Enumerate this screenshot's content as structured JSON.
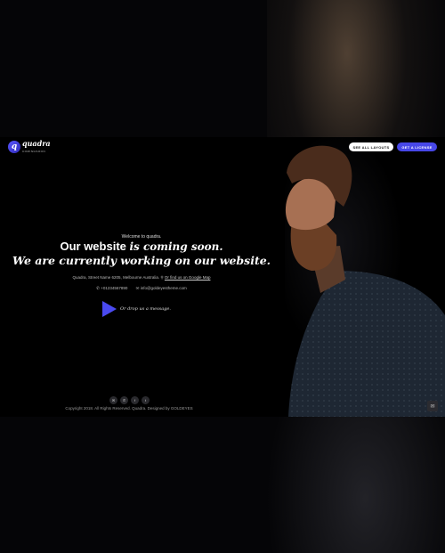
{
  "brand": {
    "name": "quadra",
    "tagline": "COMINGSOON"
  },
  "header": {
    "layouts_label": "SEE ALL LAYOUTS",
    "license_label": "GET A LICENSE"
  },
  "hero": {
    "welcome": "Welcome to quadra.",
    "title_plain": "Our website ",
    "title_italic": "is coming soon.",
    "subtitle": "We are currently working on our website."
  },
  "contact": {
    "address": "Quadra, Street Name 6205, Melbourne Australia.",
    "map_link": "Or find us on Google Map",
    "phone": "+01234567890",
    "email": "info@goldeyestheme.com"
  },
  "message": {
    "label": "Or drop us a message."
  },
  "social": [
    {
      "icon": "email-icon",
      "glyph": "✉"
    },
    {
      "icon": "phone-icon",
      "glyph": "✆"
    },
    {
      "icon": "facebook-icon",
      "glyph": "f"
    },
    {
      "icon": "twitter-icon",
      "glyph": "t"
    }
  ],
  "footer": {
    "copyright": "Copyright 2018. All Rights Reserved. Quadra. Designed by GOLDEYES"
  },
  "colors": {
    "accent": "#4747e8",
    "background": "#000000"
  }
}
